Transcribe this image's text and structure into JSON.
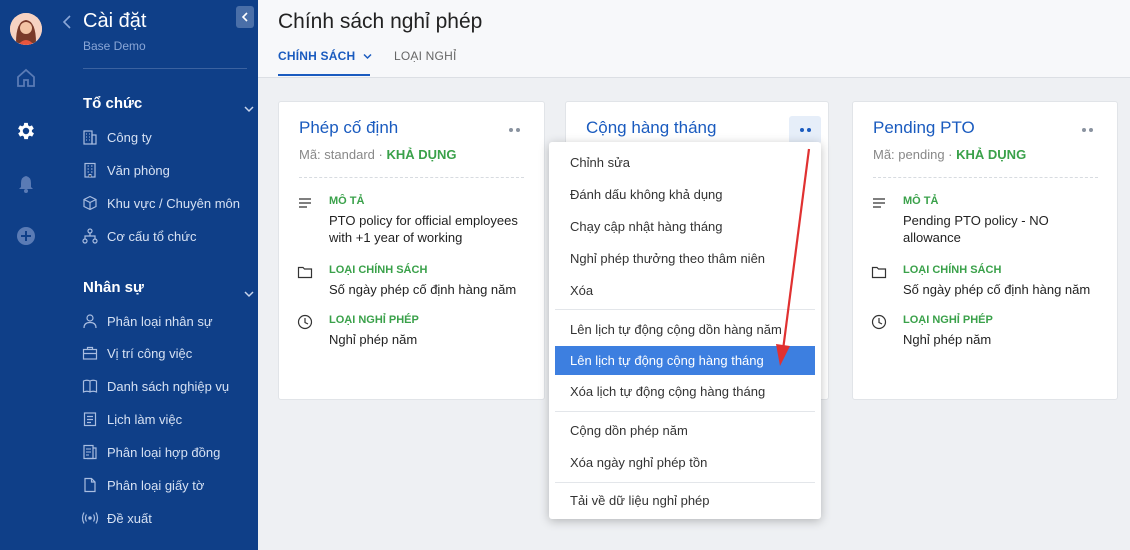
{
  "sidebar": {
    "title": "Cài đặt",
    "subtitle": "Base Demo",
    "sections": [
      {
        "title": "Tổ chức",
        "items": [
          {
            "label": "Công ty",
            "icon": "building-icon"
          },
          {
            "label": "Văn phòng",
            "icon": "office-icon"
          },
          {
            "label": "Khu vực / Chuyên môn",
            "icon": "cube-icon"
          },
          {
            "label": "Cơ cấu tổ chức",
            "icon": "org-chart-icon"
          }
        ]
      },
      {
        "title": "Nhân sự",
        "items": [
          {
            "label": "Phân loại nhân sự",
            "icon": "person-icon"
          },
          {
            "label": "Vị trí công việc",
            "icon": "briefcase-icon"
          },
          {
            "label": "Danh sách nghiệp vụ",
            "icon": "book-icon"
          },
          {
            "label": "Lịch làm việc",
            "icon": "calendar-icon"
          },
          {
            "label": "Phân loại hợp đồng",
            "icon": "contract-icon"
          },
          {
            "label": "Phân loại giấy tờ",
            "icon": "document-icon"
          },
          {
            "label": "Đề xuất",
            "icon": "broadcast-icon"
          }
        ]
      }
    ]
  },
  "header": {
    "title": "Chính sách nghỉ phép",
    "tabs": [
      {
        "label": "CHÍNH SÁCH",
        "active": true
      },
      {
        "label": "LOẠI NGHỈ",
        "active": false
      }
    ]
  },
  "cards": [
    {
      "title": "Phép cố định",
      "code": "Mã: standard",
      "status": "KHẢ DỤNG",
      "fields": [
        {
          "label": "MÔ TẢ",
          "value": "PTO policy for official employees with +1 year of working",
          "icon": "lines-icon"
        },
        {
          "label": "LOẠI CHÍNH SÁCH",
          "value": "Số ngày phép cố định hàng năm",
          "icon": "folder-icon"
        },
        {
          "label": "LOẠI NGHỈ PHÉP",
          "value": "Nghỉ phép năm",
          "icon": "clock-icon"
        }
      ]
    },
    {
      "title": "Cộng hàng tháng"
    },
    {
      "title": "Pending PTO",
      "code": "Mã: pending",
      "status": "KHẢ DỤNG",
      "fields": [
        {
          "label": "MÔ TẢ",
          "value": "Pending PTO policy - NO allowance",
          "icon": "lines-icon"
        },
        {
          "label": "LOẠI CHÍNH SÁCH",
          "value": "Số ngày phép cố định hàng năm",
          "icon": "folder-icon"
        },
        {
          "label": "LOẠI NGHỈ PHÉP",
          "value": "Nghỉ phép năm",
          "icon": "clock-icon"
        }
      ]
    }
  ],
  "menu": {
    "groups": [
      [
        "Chỉnh sửa",
        "Đánh dấu không khả dụng",
        "Chạy cập nhật hàng tháng",
        "Nghỉ phép thưởng theo thâm niên",
        "Xóa"
      ],
      [
        "Lên lịch tự động cộng dồn hàng năm",
        "Lên lịch tự động cộng hàng tháng",
        "Xóa lịch tự động cộng hàng tháng"
      ],
      [
        "Cộng dồn phép năm",
        "Xóa ngày nghỉ phép tồn"
      ],
      [
        "Tải về dữ liệu nghỉ phép"
      ]
    ],
    "highlighted": "Lên lịch tự động cộng hàng tháng"
  },
  "colors": {
    "sidebar": "#0f3f88",
    "accent": "#1a5bbf",
    "status": "#3aa14a",
    "highlight": "#3d7fe0",
    "annotation_arrow": "#e03131"
  }
}
